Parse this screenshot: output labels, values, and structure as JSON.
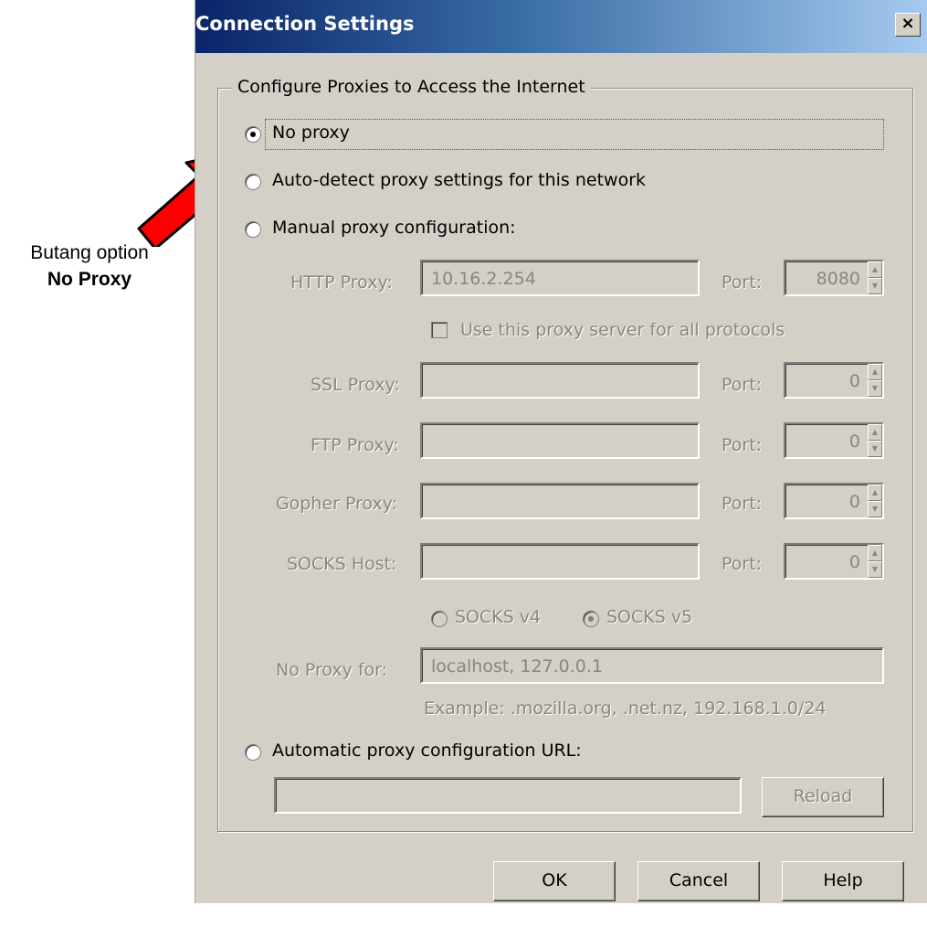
{
  "annotation": {
    "line1": "Butang option",
    "line2": "No Proxy"
  },
  "dialog": {
    "title": "Connection Settings",
    "close_label": "×",
    "group_title": "Configure Proxies to Access the Internet",
    "options": {
      "no_proxy": "No proxy",
      "auto_detect": "Auto-detect proxy settings for this network",
      "manual": "Manual proxy configuration:",
      "auto_url": "Automatic proxy configuration URL:"
    },
    "selected_option": "no_proxy",
    "manual": {
      "http_label": "HTTP Proxy:",
      "http_value": "10.16.2.254",
      "http_port_label": "Port:",
      "http_port": "8080",
      "same_proxy_label": "Use this proxy server for all protocols",
      "ssl_label": "SSL Proxy:",
      "ssl_value": "",
      "ssl_port_label": "Port:",
      "ssl_port": "0",
      "ftp_label": "FTP Proxy:",
      "ftp_value": "",
      "ftp_port_label": "Port:",
      "ftp_port": "0",
      "gopher_label": "Gopher Proxy:",
      "gopher_value": "",
      "gopher_port_label": "Port:",
      "gopher_port": "0",
      "socks_label": "SOCKS Host:",
      "socks_value": "",
      "socks_port_label": "Port:",
      "socks_port": "0",
      "socks_v4": "SOCKS v4",
      "socks_v5": "SOCKS v5",
      "socks_selected": "v5",
      "noproxy_label": "No Proxy for:",
      "noproxy_value": "localhost, 127.0.0.1",
      "example": "Example: .mozilla.org, .net.nz, 192.168.1.0/24"
    },
    "auto_url_value": "",
    "reload_label": "Reload",
    "buttons": {
      "ok": "OK",
      "cancel": "Cancel",
      "help": "Help"
    }
  },
  "colors": {
    "title_gradient_start": "#0a246a",
    "dialog_face": "#d4d0c8",
    "arrow": "#ff0000"
  },
  "icons": {
    "arrow": "red-arrow-icon",
    "close": "close-icon",
    "spin_up": "triangle-up-icon",
    "spin_down": "triangle-down-icon"
  }
}
